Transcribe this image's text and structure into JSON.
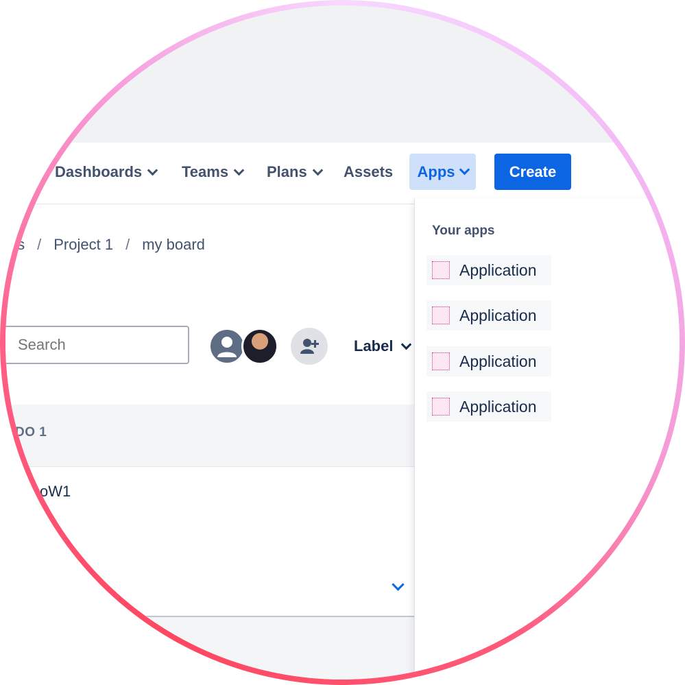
{
  "nav": {
    "items": [
      {
        "label": "Dashboards"
      },
      {
        "label": "Teams"
      },
      {
        "label": "Plans"
      },
      {
        "label": "Assets"
      }
    ],
    "apps_label": "Apps",
    "create_label": "Create"
  },
  "breadcrumb": {
    "items": [
      "cts",
      "Project 1",
      "my board"
    ],
    "separator": "/"
  },
  "toolbar": {
    "search_placeholder": "Search",
    "label_filter": "Label"
  },
  "board": {
    "column_title": "DO 1",
    "card_text": "oW1"
  },
  "apps_menu": {
    "title": "Your apps",
    "items": [
      "Application",
      "Application",
      "Application",
      "Application"
    ]
  },
  "colors": {
    "accent": "#0c66e4",
    "apps_selected_bg": "#cfe0fb",
    "nav_text": "#42526e"
  }
}
